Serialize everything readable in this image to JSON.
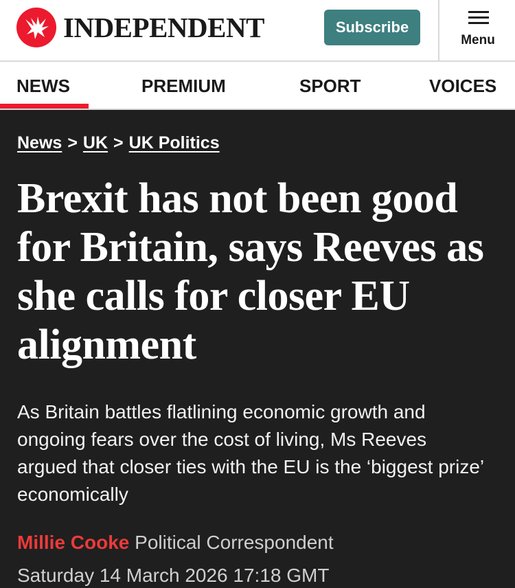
{
  "header": {
    "brand_name": "INDEPENDENT",
    "logo_icon": "eagle-logo-icon",
    "subscribe_label": "Subscribe",
    "menu_label": "Menu",
    "menu_icon": "hamburger-icon"
  },
  "nav": {
    "items": [
      {
        "label": "NEWS",
        "active": true
      },
      {
        "label": "PREMIUM",
        "active": false
      },
      {
        "label": "SPORT",
        "active": false
      },
      {
        "label": "VOICES",
        "active": false
      }
    ]
  },
  "breadcrumb": {
    "items": [
      "News",
      "UK",
      "UK Politics"
    ],
    "separator": ">"
  },
  "article": {
    "headline": "Brexit has not been good for Britain, says Reeves as she calls for closer EU alignment",
    "standfirst": "As Britain battles flatlining economic growth and ongoing fears over the cost of living, Ms Reeves argued that closer ties with the EU is the ‘biggest prize’ economically",
    "author": "Millie Cooke",
    "author_role": "Political Correspondent",
    "date": "Saturday 14 March 2026 17:18 GMT"
  },
  "colors": {
    "brand_red": "#ec1a2e",
    "subscribe_teal": "#3e7f7f",
    "background_dark": "#1f1f1f"
  }
}
